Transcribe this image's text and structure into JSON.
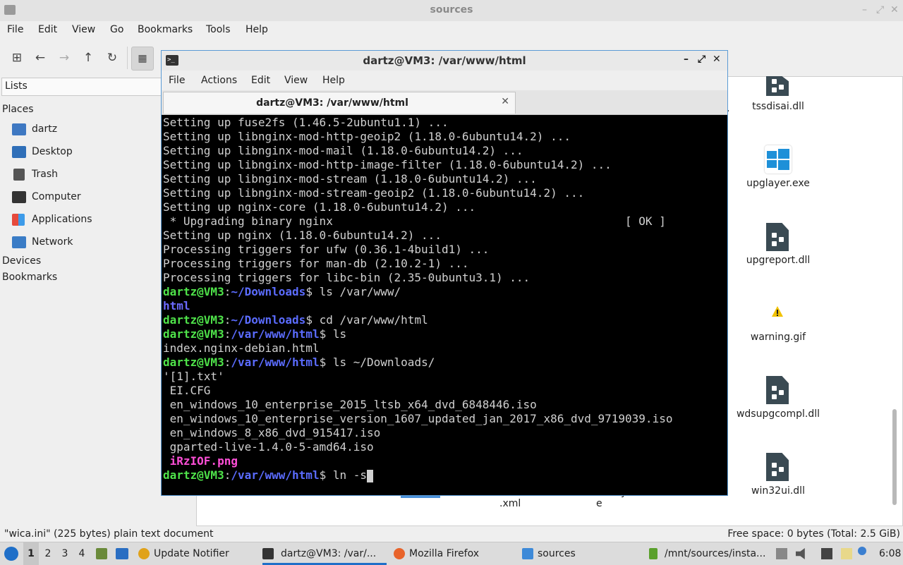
{
  "file_manager": {
    "title": "sources",
    "menu": [
      "File",
      "Edit",
      "View",
      "Go",
      "Bookmarks",
      "Tools",
      "Help"
    ],
    "sidebar": {
      "selector": "Lists",
      "places_label": "Places",
      "places": [
        "dartz",
        "Desktop",
        "Trash",
        "Computer",
        "Applications",
        "Network"
      ],
      "devices_label": "Devices",
      "bookmarks_label": "Bookmarks"
    },
    "files": [
      "tssdisai.dll",
      "upglayer.exe",
      "upgreport.dll",
      "warning.gif",
      "wdsupgcompl.dll",
      "win32ui.dll"
    ],
    "partial_labels": [
      ".",
      ".xml",
      "e",
      "y"
    ],
    "status_left": "\"wica.ini\" (225 bytes) plain text document",
    "status_right": "Free space: 0 bytes (Total: 2.5 GiB)"
  },
  "terminal": {
    "title": "dartz@VM3: /var/www/html",
    "menu": [
      "File",
      "Actions",
      "Edit",
      "View",
      "Help"
    ],
    "tab_label": "dartz@VM3: /var/www/html",
    "lines": [
      "Setting up fuse2fs (1.46.5-2ubuntu1.1) ...",
      "Setting up libnginx-mod-http-geoip2 (1.18.0-6ubuntu14.2) ...",
      "Setting up libnginx-mod-mail (1.18.0-6ubuntu14.2) ...",
      "Setting up libnginx-mod-http-image-filter (1.18.0-6ubuntu14.2) ...",
      "Setting up libnginx-mod-stream (1.18.0-6ubuntu14.2) ...",
      "Setting up libnginx-mod-stream-geoip2 (1.18.0-6ubuntu14.2) ...",
      "Setting up nginx-core (1.18.0-6ubuntu14.2) ...",
      " * Upgrading binary nginx                                           [ OK ]",
      "Setting up nginx (1.18.0-6ubuntu14.2) ...",
      "Processing triggers for ufw (0.36.1-4build1) ...",
      "Processing triggers for man-db (2.10.2-1) ...",
      "Processing triggers for libc-bin (2.35-0ubuntu3.1) ..."
    ],
    "prompt_user": "dartz@VM3",
    "prompt_sep": ":",
    "cmd1_path": "~/Downloads",
    "cmd1": "$ ls /var/www/",
    "out1": "html",
    "cmd2_path": "~/Downloads",
    "cmd2": "$ cd /var/www/html",
    "cmd3_path": "/var/www/html",
    "cmd3": "$ ls",
    "out3": "index.nginx-debian.html",
    "cmd4_path": "/var/www/html",
    "cmd4": "$ ls ~/Downloads/",
    "ls_lines": [
      "'[1].txt'",
      " EI.CFG",
      " en_windows_10_enterprise_2015_ltsb_x64_dvd_6848446.iso",
      " en_windows_10_enterprise_version_1607_updated_jan_2017_x86_dvd_9719039.iso",
      " en_windows_8_x86_dvd_915417.iso",
      " gparted-live-1.4.0-5-amd64.iso"
    ],
    "ls_highlight": " iRzIOF.png",
    "cmd5_path": "/var/www/html",
    "cmd5": "$ ln -s"
  },
  "taskbar": {
    "workspaces": [
      "1",
      "2",
      "3",
      "4"
    ],
    "tasks": [
      "Update Notifier",
      "dartz@VM3: /var/...",
      "Mozilla Firefox",
      "sources",
      "/mnt/sources/insta..."
    ],
    "clock": "6:08"
  }
}
